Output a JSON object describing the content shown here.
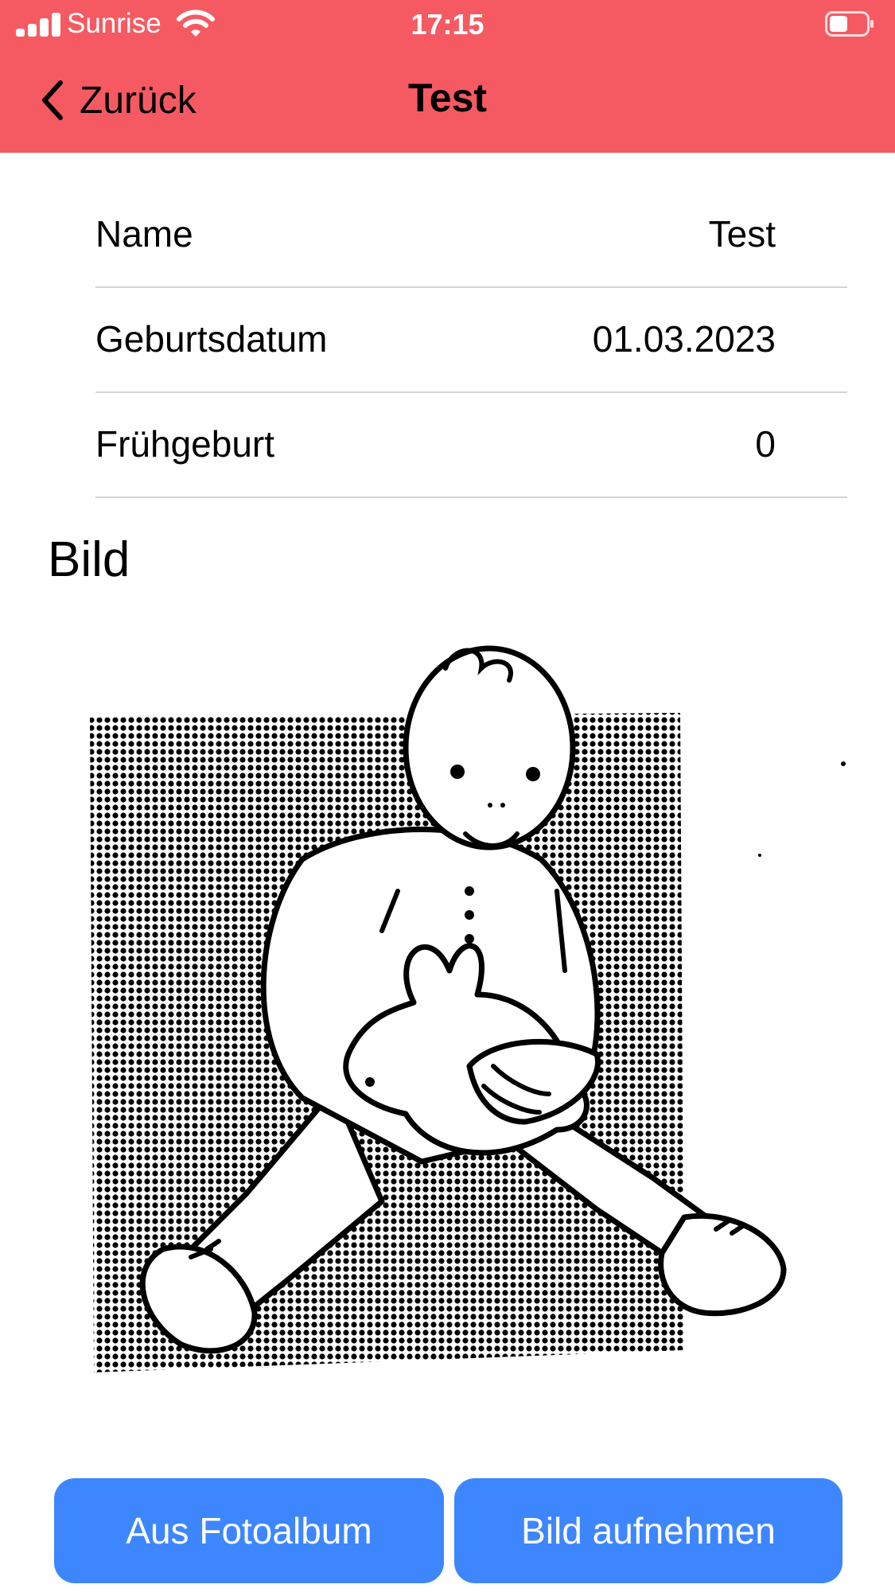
{
  "status": {
    "carrier": "Sunrise",
    "time": "17:15",
    "signal_bars": 4,
    "battery_level": 0.5
  },
  "nav": {
    "back_label": "Zurück",
    "title": "Test"
  },
  "info_rows": [
    {
      "label": "Name",
      "value": "Test"
    },
    {
      "label": "Geburtsdatum",
      "value": "01.03.2023"
    },
    {
      "label": "Frühgeburt",
      "value": "0"
    }
  ],
  "section": {
    "title": "Bild"
  },
  "picture": {
    "subject": "baby-with-rabbit-drawing"
  },
  "buttons": {
    "album": "Aus Fotoalbum",
    "camera": "Bild aufnehmen"
  },
  "colors": {
    "header": "#f55a62",
    "button": "#3d86fe",
    "separator": "#d4d4d8"
  }
}
